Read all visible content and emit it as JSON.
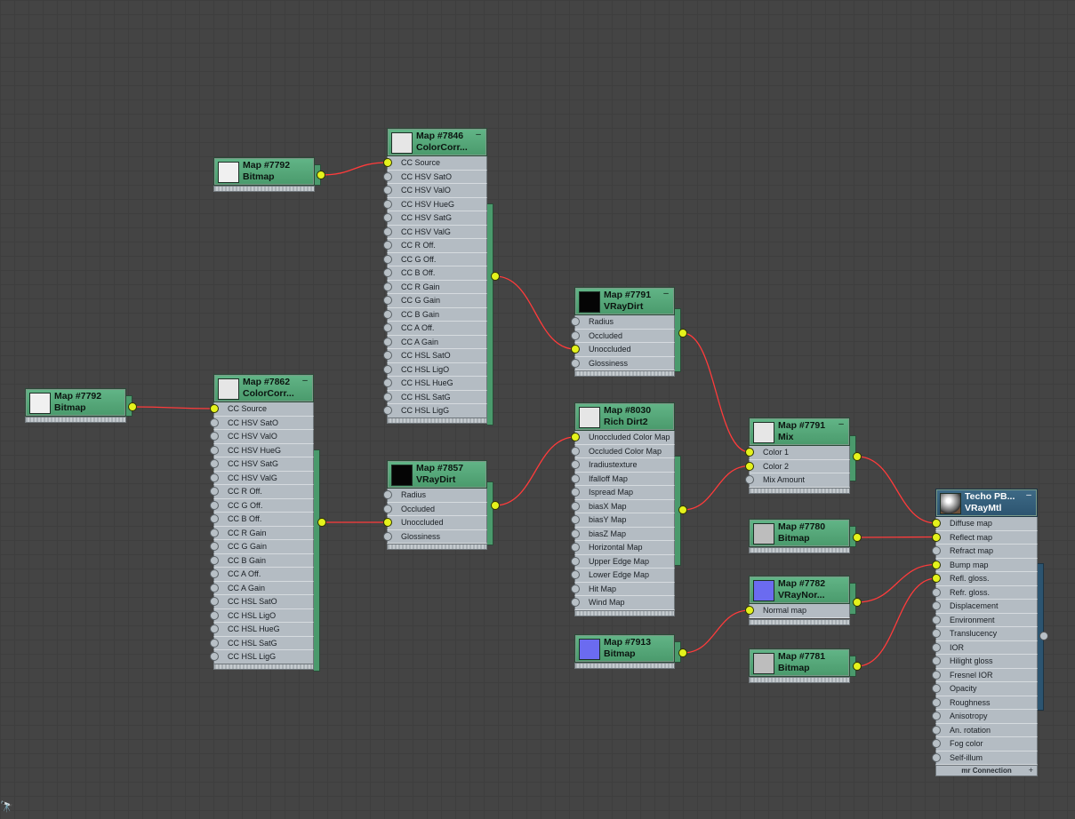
{
  "colors": {
    "background": "#444444",
    "node_header": "#4a9a6c",
    "node_header_selected": "#2c5470",
    "slot": "#b4bcc3",
    "socket_connected": "#e4f21c",
    "wire": "#ff3b3b"
  },
  "corner_icon": "binoculars-icon",
  "nodes": [
    {
      "id": "bmp7792a",
      "title": "Map #7792",
      "type": "Bitmap",
      "swatch": "#f0f0f0",
      "slots": []
    },
    {
      "id": "cc7846",
      "title": "Map #7846",
      "type": "ColorCorr...",
      "swatch": "#e6e6e6",
      "slots": [
        "CC Source",
        "CC HSV SatO",
        "CC HSV ValO",
        "CC HSV HueG",
        "CC HSV SatG",
        "CC HSV ValG",
        "CC R Off.",
        "CC G Off.",
        "CC B Off.",
        "CC R Gain",
        "CC G Gain",
        "CC B Gain",
        "CC A Off.",
        "CC A Gain",
        "CC HSL SatO",
        "CC HSL LigO",
        "CC HSL HueG",
        "CC HSL SatG",
        "CC HSL LigG"
      ]
    },
    {
      "id": "bmp7792b",
      "title": "Map #7792",
      "type": "Bitmap",
      "swatch": "#f0f0f0",
      "slots": []
    },
    {
      "id": "cc7862",
      "title": "Map #7862",
      "type": "ColorCorr...",
      "swatch": "#e6e6e6",
      "slots": [
        "CC Source",
        "CC HSV SatO",
        "CC HSV ValO",
        "CC HSV HueG",
        "CC HSV SatG",
        "CC HSV ValG",
        "CC R Off.",
        "CC G Off.",
        "CC B Off.",
        "CC R Gain",
        "CC G Gain",
        "CC B Gain",
        "CC A Off.",
        "CC A Gain",
        "CC HSL SatO",
        "CC HSL LigO",
        "CC HSL HueG",
        "CC HSL SatG",
        "CC HSL LigG"
      ]
    },
    {
      "id": "vd7857",
      "title": "Map #7857",
      "type": "VRayDirt",
      "swatch": "#050505",
      "slots": [
        "Radius",
        "Occluded",
        "Unoccluded",
        "Glossiness"
      ]
    },
    {
      "id": "vd7791",
      "title": "Map #7791",
      "type": "VRayDirt",
      "swatch": "#050505",
      "slots": [
        "Radius",
        "Occluded",
        "Unoccluded",
        "Glossiness"
      ]
    },
    {
      "id": "rd8030",
      "title": "Map #8030",
      "type": "Rich Dirt2",
      "swatch": "#e6e6e6",
      "slots": [
        "Unoccluded Color Map",
        "Occluded Color Map",
        "Iradiustexture",
        "Ifalloff Map",
        "Ispread Map",
        "biasX Map",
        "biasY Map",
        "biasZ Map",
        "Horizontal  Map",
        "Upper Edge Map",
        "Lower Edge Map",
        "Hit Map",
        "Wind Map"
      ]
    },
    {
      "id": "bmp7913",
      "title": "Map #7913",
      "type": "Bitmap",
      "swatch": "#6b6bf0",
      "slots": []
    },
    {
      "id": "mix7791",
      "title": "Map #7791",
      "type": "Mix",
      "swatch": "#e6e6e6",
      "slots": [
        "Color 1",
        "Color 2",
        "Mix Amount"
      ]
    },
    {
      "id": "bmp7780",
      "title": "Map #7780",
      "type": "Bitmap",
      "swatch": "#bdbdbd",
      "slots": []
    },
    {
      "id": "vn7782",
      "title": "Map #7782",
      "type": "VRayNor...",
      "swatch": "#6b6bf0",
      "slots": [
        "Normal map"
      ]
    },
    {
      "id": "bmp7781",
      "title": "Map #7781",
      "type": "Bitmap",
      "swatch": "#bdbdbd",
      "slots": []
    },
    {
      "id": "vrm",
      "title": "Techo PB...",
      "type": "VRayMtl",
      "swatch": "#888888",
      "slots": [
        "Diffuse map",
        "Reflect map",
        "Refract map",
        "Bump map",
        "Refl. gloss.",
        "Refr. gloss.",
        "Displacement",
        "Environment",
        "Translucency",
        "IOR",
        "Hilight gloss",
        "Fresnel IOR",
        "Opacity",
        "Roughness",
        "Anisotropy",
        "An. rotation",
        "Fog color",
        "Self-illum"
      ],
      "footer": "mr Connection"
    }
  ]
}
